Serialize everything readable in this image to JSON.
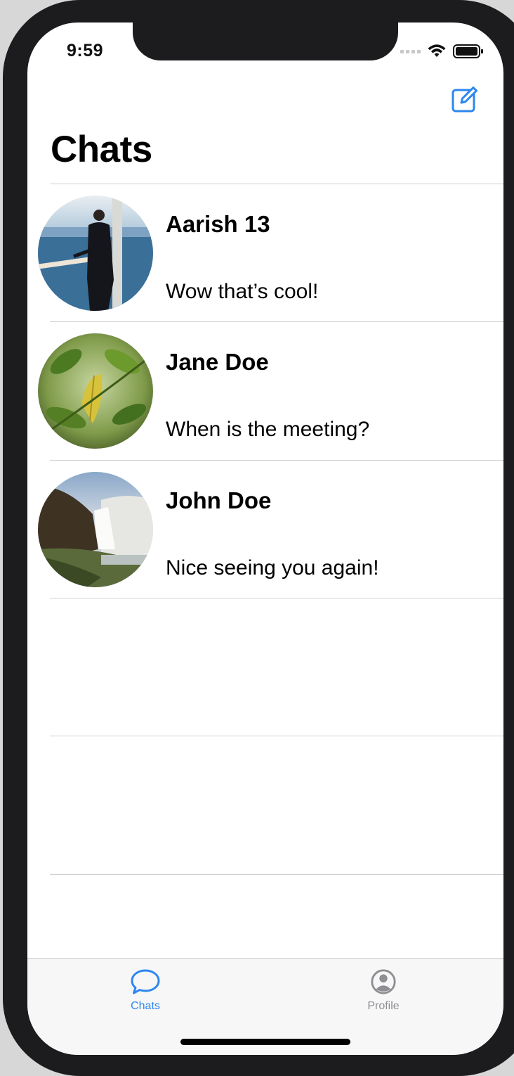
{
  "status_bar": {
    "time": "9:59"
  },
  "nav": {
    "title": "Chats",
    "compose_icon": "compose-icon"
  },
  "chats": [
    {
      "name": "Aarish 13",
      "last_message": "Wow that’s cool!"
    },
    {
      "name": "Jane Doe",
      "last_message": "When is the meeting?"
    },
    {
      "name": "John Doe",
      "last_message": "Nice seeing you again!"
    }
  ],
  "tab_bar": {
    "tabs": [
      {
        "label": "Chats",
        "icon": "chat-bubble-icon",
        "active": true
      },
      {
        "label": "Profile",
        "icon": "person-circle-icon",
        "active": false
      }
    ]
  },
  "colors": {
    "accent": "#2d87f0",
    "inactive": "#8e8e93",
    "frame": "#1c1c1e"
  }
}
